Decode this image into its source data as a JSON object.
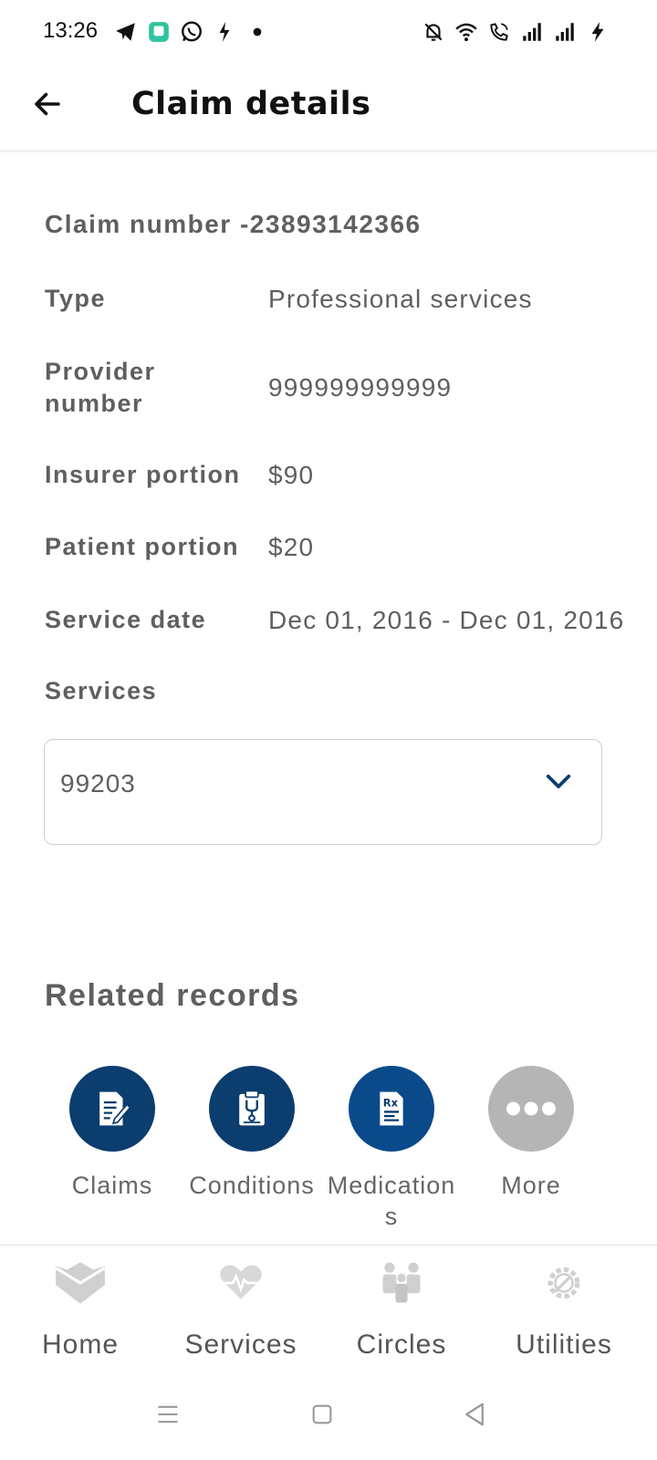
{
  "status_bar": {
    "time": "13:26",
    "left_icons": [
      "telegram-icon",
      "app-icon",
      "whatsapp-icon",
      "bolt-app-icon",
      "dot-icon"
    ],
    "right_icons": [
      "mute-bell-icon",
      "wifi-icon",
      "wifi-call-icon",
      "signal-icon",
      "signal-icon",
      "charging-icon"
    ]
  },
  "app_bar": {
    "title": "Claim details"
  },
  "claim": {
    "number_label": "Claim number -23893142366",
    "fields": [
      {
        "label": "Type",
        "value": "Professional services"
      },
      {
        "label": "Provider number",
        "value": "999999999999"
      },
      {
        "label": "Insurer portion",
        "value": "$90"
      },
      {
        "label": "Patient portion",
        "value": "$20"
      },
      {
        "label": "Service date",
        "value": "Dec 01, 2016 - Dec 01, 2016"
      }
    ],
    "services_label": "Services",
    "services_selected": "99203"
  },
  "related": {
    "title": "Related records",
    "items": [
      {
        "label": "Claims",
        "icon": "claims-icon",
        "color": "#0b3d6e"
      },
      {
        "label": "Conditions",
        "icon": "conditions-icon",
        "color": "#0b3d6e"
      },
      {
        "label": "Medication\ns",
        "icon": "medications-icon",
        "color": "#0b4a8a"
      },
      {
        "label": "More",
        "icon": "more-icon",
        "color": "#b5b5b5"
      }
    ]
  },
  "bottom_nav": {
    "items": [
      {
        "label": "Home",
        "icon": "home-icon"
      },
      {
        "label": "Services",
        "icon": "heartbeat-icon"
      },
      {
        "label": "Circles",
        "icon": "people-icon"
      },
      {
        "label": "Utilities",
        "icon": "gear-wrench-icon"
      }
    ]
  },
  "colors": {
    "accent": "#0b3d6e",
    "text": "#5f5f5f",
    "nav_icon": "#c8c8c8"
  }
}
